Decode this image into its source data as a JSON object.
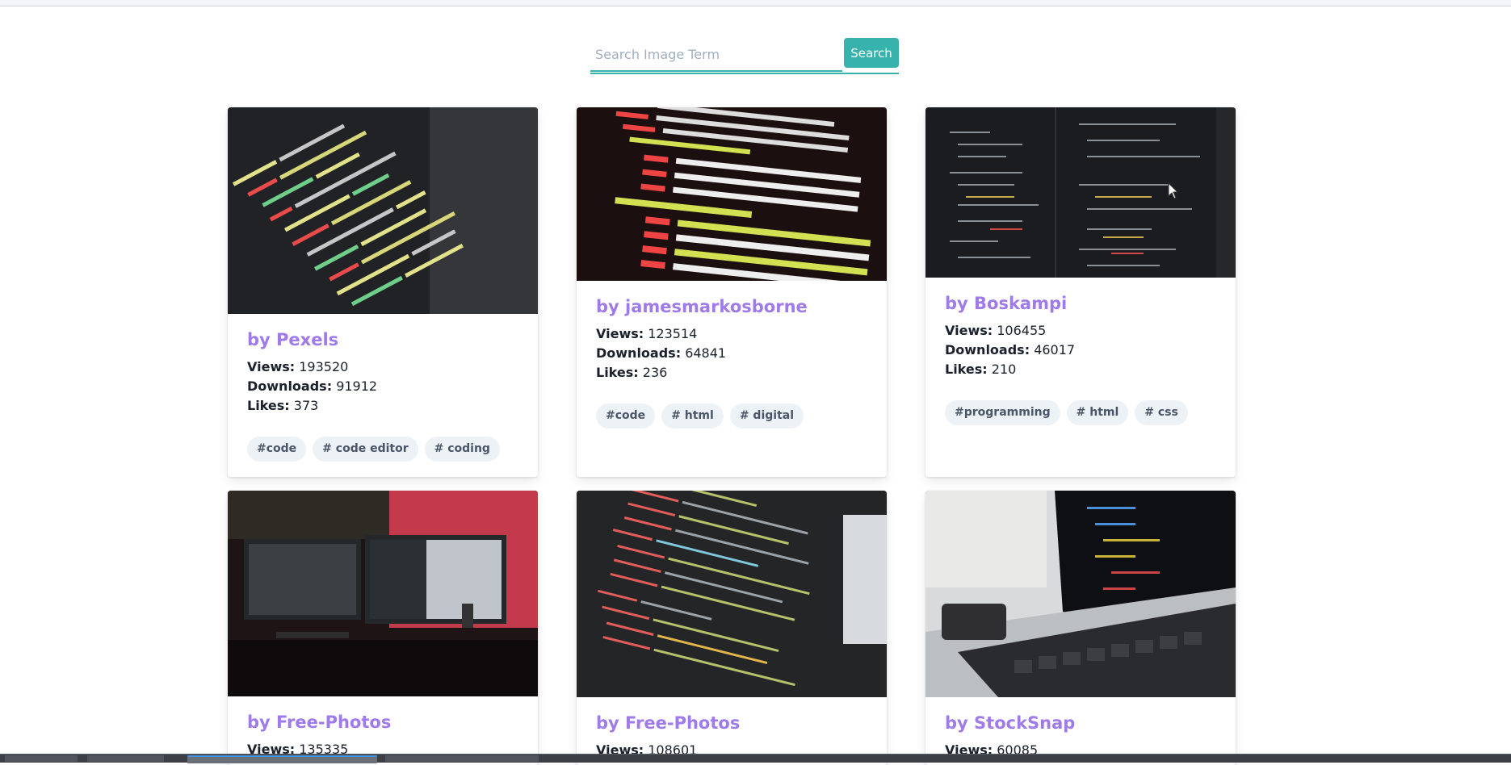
{
  "search": {
    "placeholder": "Search Image Term",
    "button_label": "Search"
  },
  "colors": {
    "accent": "#38b2ac",
    "author": "#9f7aea",
    "tag_bg": "#edf2f7"
  },
  "cards": [
    {
      "author": "by Pexels",
      "views_label": "Views:",
      "views": "193520",
      "downloads_label": "Downloads:",
      "downloads": "91912",
      "likes_label": "Likes:",
      "likes": "373",
      "tags": [
        "#code",
        "# code editor",
        "# coding"
      ]
    },
    {
      "author": "by jamesmarkosborne",
      "views_label": "Views:",
      "views": "123514",
      "downloads_label": "Downloads:",
      "downloads": "64841",
      "likes_label": "Likes:",
      "likes": "236",
      "tags": [
        "#code",
        "# html",
        "# digital"
      ]
    },
    {
      "author": "by Boskampi",
      "views_label": "Views:",
      "views": "106455",
      "downloads_label": "Downloads:",
      "downloads": "46017",
      "likes_label": "Likes:",
      "likes": "210",
      "tags": [
        "#programming",
        "# html",
        "# css"
      ]
    },
    {
      "author": "by Free-Photos",
      "views_label": "Views:",
      "views": "135335"
    },
    {
      "author": "by Free-Photos",
      "views_label": "Views:",
      "views": "108601"
    },
    {
      "author": "by StockSnap",
      "views_label": "Views:",
      "views": "60085"
    }
  ]
}
